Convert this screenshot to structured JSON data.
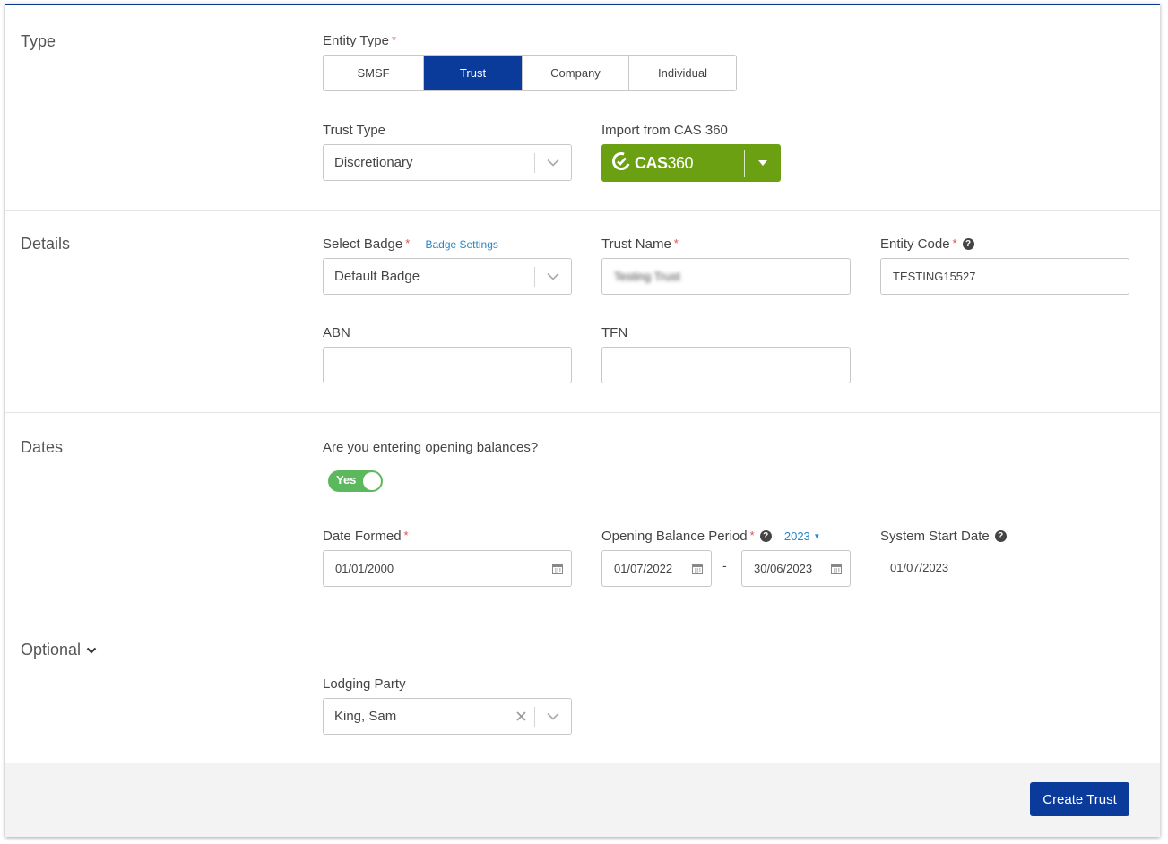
{
  "sections": {
    "type": "Type",
    "details": "Details",
    "dates": "Dates",
    "optional": "Optional"
  },
  "entity_type": {
    "label": "Entity Type",
    "required": "*",
    "options": [
      "SMSF",
      "Trust",
      "Company",
      "Individual"
    ],
    "selected": "Trust"
  },
  "trust_type": {
    "label": "Trust Type",
    "value": "Discretionary"
  },
  "import_cas": {
    "label": "Import from CAS 360",
    "logo_bold": "CAS",
    "logo_light": "360"
  },
  "badge": {
    "label": "Select Badge",
    "required": "*",
    "settings_link": "Badge Settings",
    "value": "Default Badge"
  },
  "trust_name": {
    "label": "Trust Name",
    "required": "*",
    "value": "Testing Trust"
  },
  "entity_code": {
    "label": "Entity Code",
    "required": "*",
    "value": "TESTING15527"
  },
  "abn": {
    "label": "ABN",
    "value": ""
  },
  "tfn": {
    "label": "TFN",
    "value": ""
  },
  "opening_balances": {
    "question": "Are you entering opening balances?",
    "toggle_label": "Yes"
  },
  "date_formed": {
    "label": "Date Formed",
    "required": "*",
    "value": "01/01/2000"
  },
  "opening_balance_period": {
    "label": "Opening Balance Period",
    "required": "*",
    "year": "2023",
    "start": "01/07/2022",
    "separator": "-",
    "end": "30/06/2023"
  },
  "system_start_date": {
    "label": "System Start Date",
    "value": "01/07/2023"
  },
  "lodging_party": {
    "label": "Lodging Party",
    "value": "King, Sam"
  },
  "footer": {
    "create_button": "Create Trust"
  },
  "colors": {
    "primary": "#0a3a9a",
    "cas_green": "#6aa012",
    "toggle_green": "#5cb85c",
    "required_red": "#d9534f",
    "link_blue": "#2a86c8"
  }
}
